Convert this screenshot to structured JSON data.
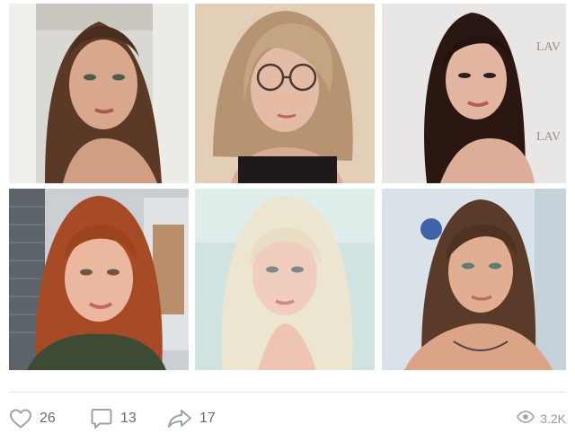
{
  "post": {
    "photos": [
      {
        "name": "photo-1"
      },
      {
        "name": "photo-2"
      },
      {
        "name": "photo-3"
      },
      {
        "name": "photo-4"
      },
      {
        "name": "photo-5"
      },
      {
        "name": "photo-6"
      }
    ],
    "watermarks": {
      "photo3_text_1": "LAV",
      "photo3_text_2": "LAV"
    }
  },
  "actions": {
    "likes": "26",
    "comments": "13",
    "shares": "17",
    "views": "3.2K"
  },
  "icons": {
    "like": "heart-icon",
    "comment": "comment-icon",
    "share": "share-icon",
    "views": "eye-icon"
  },
  "colors": {
    "icon": "#99a2ad",
    "count": "#626d7a",
    "views": "#939ca7"
  }
}
